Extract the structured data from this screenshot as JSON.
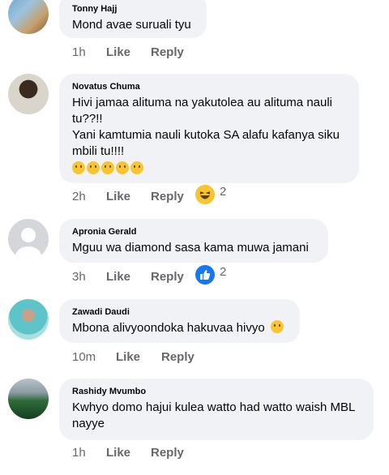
{
  "comments": [
    {
      "author": "Tonny Hajj",
      "lines": [
        "Mond avae suruali tyu"
      ],
      "time": "1h",
      "like": "Like",
      "reply": "Reply"
    },
    {
      "author": "Novatus Chuma",
      "lines": [
        "Hivi jamaa alituma na yakutolea au alituma nauli",
        "tu??!!",
        "Yani kamtumia nauli kutoka SA alafu kafanya siku",
        "mbili tu!!!!"
      ],
      "emoji_count": 5,
      "time": "2h",
      "like": "Like",
      "reply": "Reply",
      "reaction": {
        "icon": "laughing-reaction-icon",
        "count": "2"
      }
    },
    {
      "author": "Apronia Gerald",
      "lines": [
        "Mguu wa diamond sasa kama muwa jamani"
      ],
      "time": "3h",
      "like": "Like",
      "reply": "Reply",
      "reaction": {
        "icon": "like-reaction-icon",
        "count": "2"
      }
    },
    {
      "author": "Zawadi Daudi",
      "lines": [
        "Mbona alivyoondoka hakuvaa hivyo"
      ],
      "time": "10m",
      "like": "Like",
      "reply": "Reply"
    },
    {
      "author": "Rashidy Mvumbo",
      "lines": [
        "Kwhyo domo hajui kulea watto had watto waish MBL",
        "nayye"
      ],
      "time": "1h",
      "like": "Like",
      "reply": "Reply"
    }
  ],
  "colors": {
    "bubble": "#f0f2f5",
    "meta": "#65676b",
    "like_blue": "#1877f2",
    "emoji_yellow": "#f7c531"
  }
}
